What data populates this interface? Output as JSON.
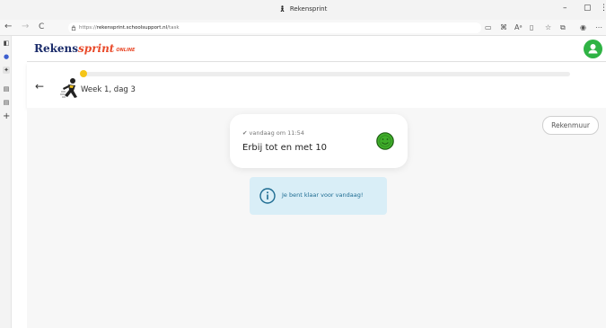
{
  "window": {
    "title": "Rekensprint",
    "minimize_icon": "–",
    "restore_icon": "▢",
    "more_icon": "⋮"
  },
  "browser": {
    "url_prefix": "https://",
    "url_host": "rekensprint.schoolsupport.nl",
    "url_path": "/task",
    "back_icon": "←",
    "forward_icon": "→",
    "reload_icon": "C",
    "toolbar_icons": [
      "▭",
      "⌘",
      "Aᵃ",
      "▯",
      "☆",
      "⧉",
      "◉",
      "⋯"
    ]
  },
  "vertical_tabs": {
    "icons": [
      "◧",
      "●",
      "✦",
      "▤",
      "▤",
      "+"
    ]
  },
  "app": {
    "logo_rekens": "Rekens",
    "logo_sprint": "sprint",
    "logo_online": "ONLINE",
    "avatar_color": "#2fb344",
    "accent_color": "#f5c518",
    "back_arrow": "←",
    "week_label": "Week 1, dag 3",
    "progress": 0.0,
    "rekenmuur_label": "Rekenmuur",
    "task_card": {
      "check": "✔",
      "timestamp": "vandaag om 11:54",
      "title": "Erbij tot en met 10"
    },
    "info_banner": {
      "message": "Je bent klaar voor vandaag!"
    }
  }
}
